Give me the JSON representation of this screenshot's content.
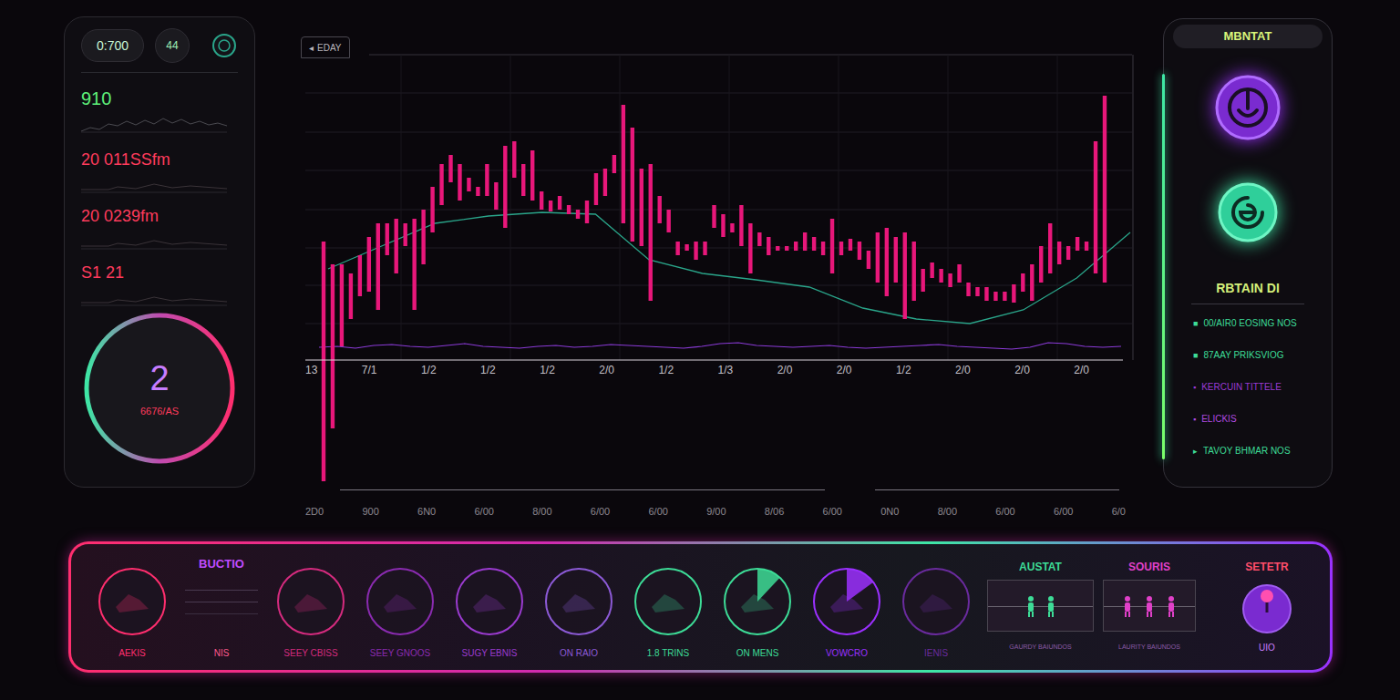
{
  "status_panel": {
    "time": "0:700",
    "badge": "44",
    "primary_value": "910",
    "readings": [
      "20 011SSfm",
      "20 0239fm",
      "S1 21"
    ],
    "gauge": {
      "value": "2",
      "label": "6676/AS"
    }
  },
  "chart": {
    "tag_icon": "◂",
    "tag": "EDAY",
    "x_ticks": [
      "13",
      "7/1",
      "1/2",
      "1/2",
      "1/2",
      "2/0",
      "1/2",
      "1/3",
      "2/0",
      "2/0",
      "1/2",
      "2/0",
      "2/0",
      "2/0"
    ],
    "x_ticks_secondary": [
      "2D0",
      "900",
      "6N0",
      "6/00",
      "8/00",
      "6/00",
      "6/00",
      "9/00",
      "8/06",
      "6/00",
      "0N0",
      "8/00",
      "6/00",
      "6/00",
      "6/0"
    ],
    "series": {
      "bar_high": [
        130,
        105,
        105,
        95,
        115,
        135,
        150,
        150,
        155,
        150,
        155,
        165,
        190,
        215,
        225,
        215,
        200,
        190,
        215,
        195,
        235,
        240,
        215,
        230,
        185,
        175,
        180,
        170,
        165,
        175,
        205,
        210,
        225,
        280,
        255,
        210,
        215,
        180,
        165,
        130,
        127,
        130,
        130,
        170,
        160,
        150,
        170,
        150,
        140,
        135,
        125,
        125,
        130,
        140,
        135,
        130,
        155,
        130,
        133,
        130,
        120,
        140,
        145,
        135,
        140,
        130,
        100,
        107,
        100,
        95,
        105,
        85,
        80,
        80,
        75,
        75,
        83,
        95,
        105,
        125,
        150,
        130,
        125,
        135,
        130,
        240,
        290
      ],
      "bar_low": [
        -133,
        -75,
        15,
        45,
        70,
        75,
        55,
        115,
        95,
        125,
        55,
        105,
        140,
        170,
        195,
        175,
        185,
        180,
        180,
        165,
        145,
        200,
        180,
        175,
        165,
        163,
        165,
        160,
        155,
        150,
        170,
        180,
        205,
        150,
        130,
        125,
        65,
        150,
        140,
        115,
        120,
        110,
        115,
        145,
        135,
        140,
        125,
        95,
        125,
        115,
        120,
        120,
        120,
        120,
        120,
        115,
        95,
        115,
        120,
        110,
        100,
        85,
        70,
        85,
        45,
        65,
        75,
        90,
        85,
        80,
        85,
        70,
        70,
        65,
        65,
        65,
        63,
        75,
        65,
        85,
        95,
        105,
        110,
        120,
        120,
        95,
        85
      ],
      "moving_average": [
        100,
        125,
        150,
        158,
        162,
        160,
        110,
        95,
        88,
        80,
        57,
        45,
        40,
        55,
        90,
        140
      ],
      "volume": [
        14,
        15,
        13,
        16,
        17,
        15,
        14,
        16,
        18,
        15,
        14,
        13,
        15,
        16,
        14,
        15,
        17,
        16,
        15,
        14,
        13,
        15,
        18,
        19,
        16,
        15,
        14,
        15,
        16,
        14,
        13,
        14,
        15,
        16,
        17,
        15,
        14,
        13,
        12,
        14,
        19,
        18,
        15,
        14,
        15
      ]
    }
  },
  "side_panel": {
    "title": "MBNTAT",
    "section": "RBTAIN DI",
    "items": [
      {
        "marker": "■",
        "label": "00/AIR0 EOSING NOS",
        "color": "#3ddc97"
      },
      {
        "marker": "■",
        "label": "87AAY PRIKSVIOG",
        "color": "#3ddc97"
      },
      {
        "marker": "▪",
        "label": "KERCUIN TITTELE",
        "color": "#9b3bd6"
      },
      {
        "marker": "▪",
        "label": "ELICKIS",
        "color": "#b04be0"
      },
      {
        "marker": "▸",
        "label": "TAVOY BHMAR NOS",
        "color": "#3ddc97"
      }
    ]
  },
  "controls": {
    "items": [
      {
        "kind": "dial",
        "label": "AEKIS",
        "color": "#ff2e6e",
        "level": 0
      },
      {
        "kind": "info",
        "title": "BUCTIO",
        "label": "NIS",
        "color": "#c04bff",
        "level": 0
      },
      {
        "kind": "dial",
        "label": "SEEY CBISS",
        "color": "#d62b7f",
        "level": 0
      },
      {
        "kind": "dial",
        "label": "SEEY GNOOS",
        "color": "#8a2bb0",
        "level": 0
      },
      {
        "kind": "dial",
        "label": "SUGY EBNIS",
        "color": "#9b3bd0",
        "level": 0
      },
      {
        "kind": "dial",
        "label": "ON RAIO",
        "color": "#8c5ad6",
        "level": 0
      },
      {
        "kind": "dial",
        "label": "1.8 TRINS",
        "color": "#3ddc97",
        "level": 0
      },
      {
        "kind": "dial",
        "label": "ON MENS",
        "color": "#3ddc97",
        "level": 0.12
      },
      {
        "kind": "dial",
        "label": "VOWCRO",
        "color": "#9b30ff",
        "level": 0.15
      },
      {
        "kind": "dial",
        "label": "IENIS",
        "color": "#6a2b9e",
        "level": 0
      }
    ],
    "groups": [
      {
        "title": "AUSTAT",
        "caption": "GAURDY BAIUNDOS",
        "count": 2,
        "color": "#3ddc97"
      },
      {
        "title": "SOURIS",
        "caption": "LAURITY BAIUNDOS",
        "count": 3,
        "color": "#e040c8"
      }
    ],
    "knob": {
      "title": "SETETR",
      "label": "UIO"
    }
  }
}
